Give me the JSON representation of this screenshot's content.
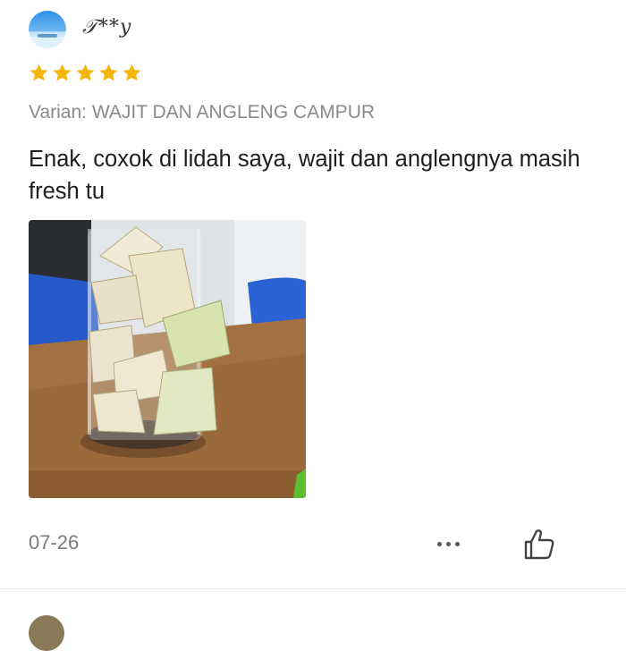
{
  "review": {
    "username": "𝒯**y",
    "rating": 5,
    "rating_max": 5,
    "variant": "Varian: WAJIT DAN ANGLENG CAMPUR",
    "text": "Enak, coxok di lidah saya, wajit dan anglengnya masih fresh tu",
    "date": "07-26",
    "star_color": "#f5b50a"
  },
  "icons": {
    "more": "more-options-icon",
    "like": "thumbs-up-icon"
  }
}
